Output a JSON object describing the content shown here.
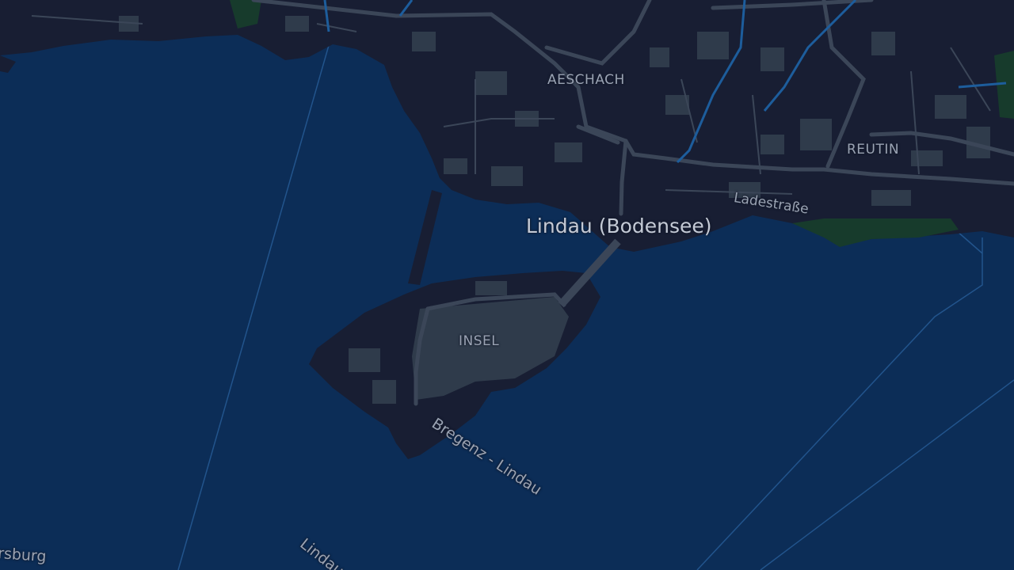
{
  "map": {
    "colors": {
      "water": "#0c2d57",
      "land": "#181e33",
      "buildings": "#2f3b4b",
      "roads": "#3b4658",
      "rivers": "#1d5d9c",
      "green": "#173b2c"
    },
    "labels": {
      "town": "Lindau (Bodensee)",
      "district_aeschach": "AESCHACH",
      "district_reutin": "REUTIN",
      "district_insel": "INSEL",
      "street_ladestrasse": "Ladestraße",
      "ferry_bregenz_lindau": "Bregenz - Lindau",
      "place_partial_burg": "rsburg",
      "ferry_partial_lindau": "Lindau"
    }
  }
}
